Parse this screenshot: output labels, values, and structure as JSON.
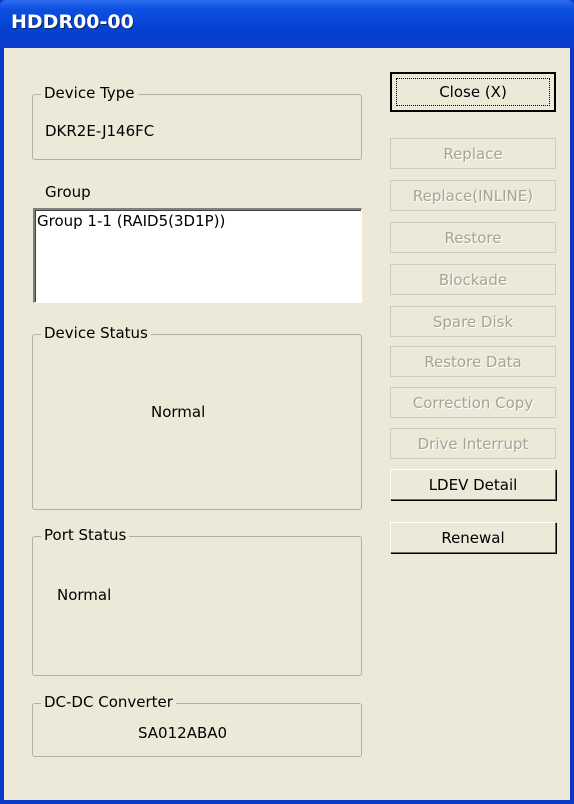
{
  "window": {
    "title": "HDDR00-00"
  },
  "device_type": {
    "legend": "Device Type",
    "value": "DKR2E-J146FC"
  },
  "group": {
    "label": "Group",
    "items": [
      "Group 1-1 (RAID5(3D1P))"
    ]
  },
  "device_status": {
    "legend": "Device Status",
    "value": "Normal"
  },
  "port_status": {
    "legend": "Port Status",
    "value": "Normal"
  },
  "dcdc_converter": {
    "legend": "DC-DC Converter",
    "value": "SA012ABA0"
  },
  "buttons": {
    "close": "Close (X)",
    "replace": "Replace",
    "replace_inline": "Replace(INLINE)",
    "restore": "Restore",
    "blockade": "Blockade",
    "spare_disk": "Spare Disk",
    "restore_data": "Restore Data",
    "correction_copy": "Correction Copy",
    "drive_interrupt": "Drive Interrupt",
    "ldev_detail": "LDEV Detail",
    "renewal": "Renewal"
  }
}
